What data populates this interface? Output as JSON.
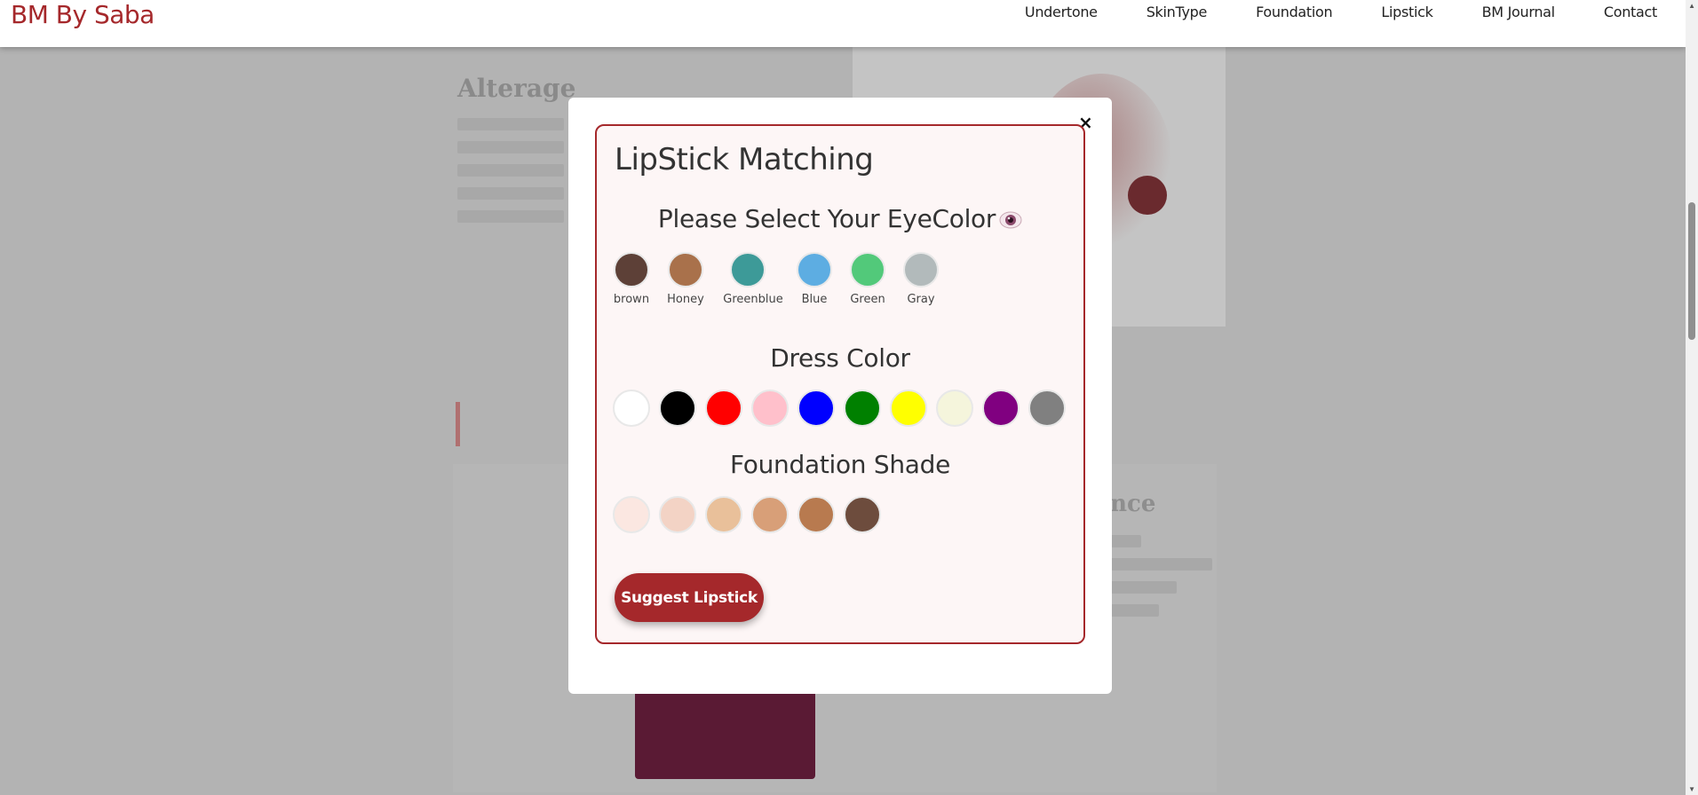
{
  "nav": {
    "brand": "BM By Saba",
    "links": [
      "Undertone",
      "SkinType",
      "Foundation",
      "Lipstick",
      "BM Journal",
      "Contact"
    ]
  },
  "background": {
    "heading": "Alterage",
    "heading2": "rience"
  },
  "modal": {
    "close": "×",
    "title": "LipStick Matching",
    "eye_section": {
      "title": "Please Select Your EyeColor",
      "icon": "eye-icon",
      "options": [
        {
          "label": "brown",
          "color": "#5d4037"
        },
        {
          "label": "Honey",
          "color": "#a9714b"
        },
        {
          "label": "Greenblue",
          "color": "#3d9a98"
        },
        {
          "label": "Blue",
          "color": "#5dade2"
        },
        {
          "label": "Green",
          "color": "#52c97a"
        },
        {
          "label": "Gray",
          "color": "#b2babb"
        }
      ]
    },
    "dress_section": {
      "title": "Dress Color",
      "colors": [
        "#ffffff",
        "#000000",
        "#ff0000",
        "#ffc0cb",
        "#0000ff",
        "#008000",
        "#ffff00",
        "#f5f5dc",
        "#800080",
        "#808080"
      ]
    },
    "foundation_section": {
      "title": "Foundation Shade",
      "colors": [
        "#fbe7e1",
        "#f3d3c5",
        "#e9c09a",
        "#d89f78",
        "#b87a4f",
        "#6d4c3d"
      ]
    },
    "submit_label": "Suggest Lipstick"
  }
}
